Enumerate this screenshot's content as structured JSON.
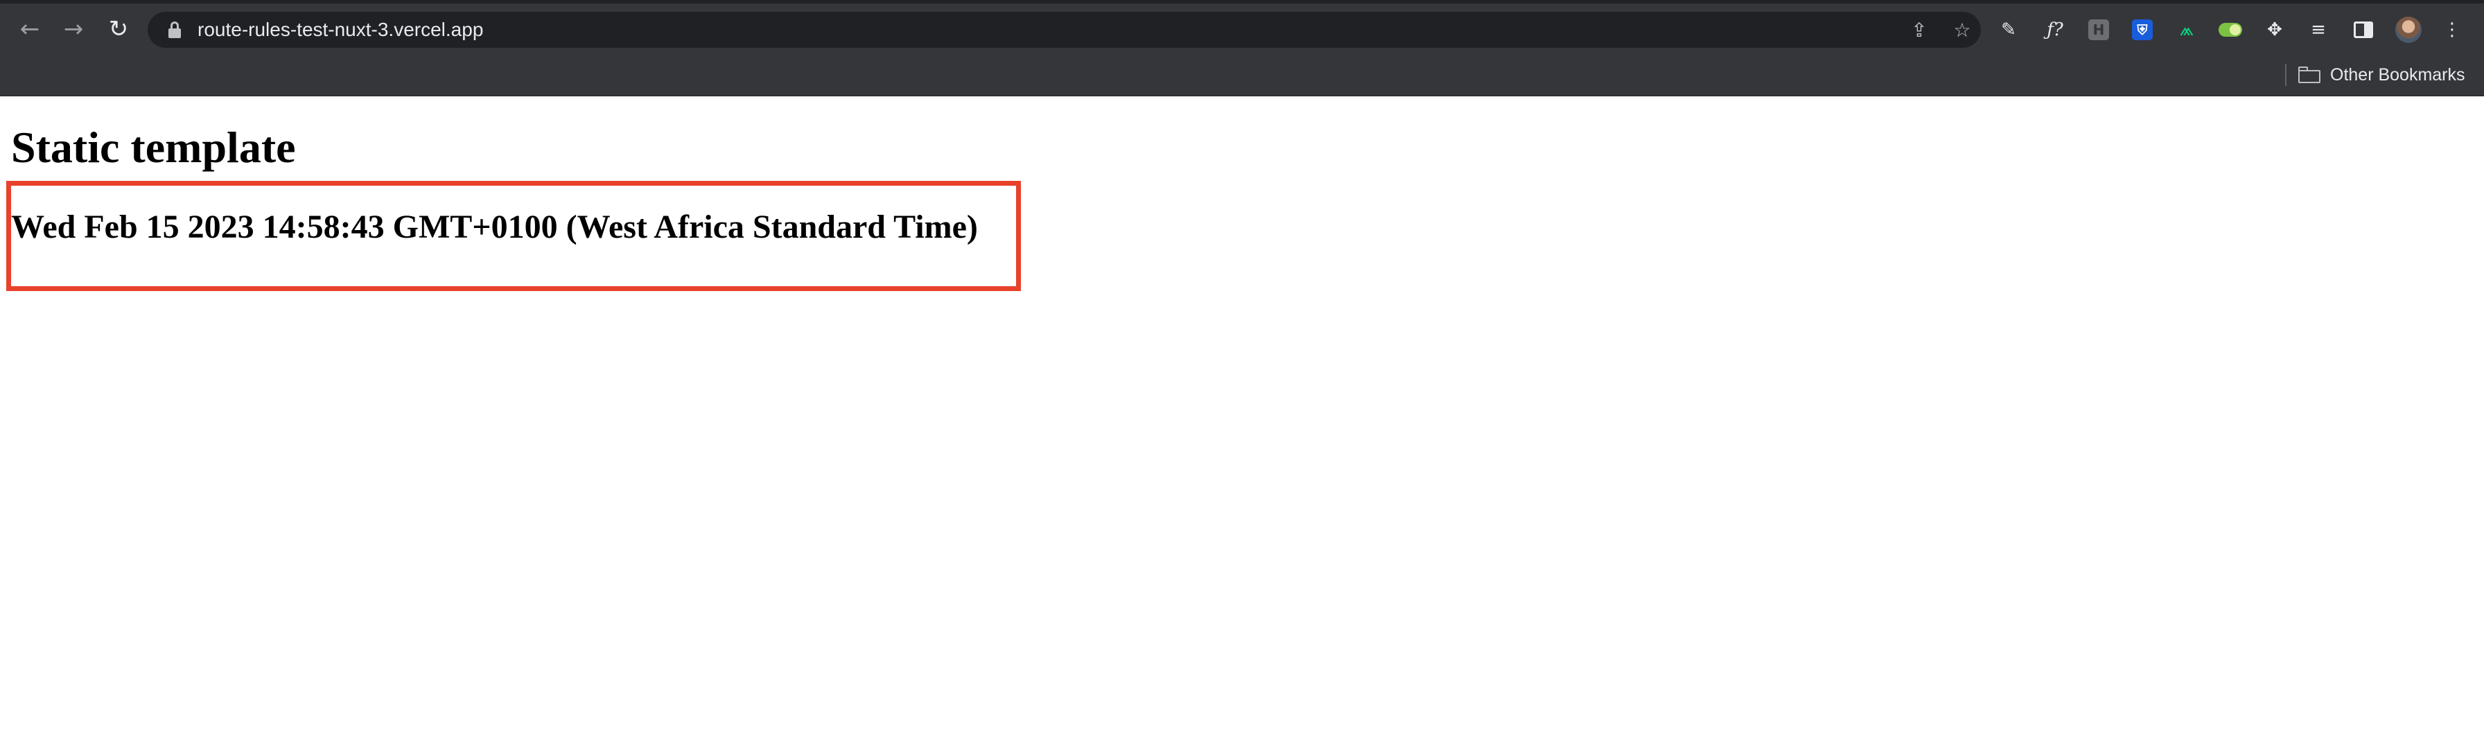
{
  "browser": {
    "address_bar": {
      "url": "route-rules-test-nuxt-3.vercel.app"
    },
    "nav": {
      "back_icon": "arrow-left-icon",
      "forward_icon": "arrow-right-icon",
      "reload_icon": "reload-icon"
    },
    "omnibox_actions": [
      "share-icon",
      "star-icon"
    ],
    "extensions": [
      {
        "name": "pen-extension-icon",
        "glyph": "✎"
      },
      {
        "name": "fx-extension-icon",
        "glyph": "ƒ?"
      },
      {
        "name": "h-extension-icon",
        "glyph": "H"
      },
      {
        "name": "bitwarden-extension-icon",
        "glyph": "⛨"
      },
      {
        "name": "nuxt-extension-icon",
        "glyph": "⩕"
      },
      {
        "name": "toggle-extension-icon",
        "glyph": "●"
      },
      {
        "name": "puzzle-extension-icon",
        "glyph": "✥"
      },
      {
        "name": "reading-list-icon",
        "glyph": "≡"
      },
      {
        "name": "side-panel-icon",
        "glyph": "▮"
      },
      {
        "name": "profile-avatar",
        "glyph": ""
      },
      {
        "name": "kebab-menu-icon",
        "glyph": "⋮"
      }
    ],
    "colors": {
      "frame": "#35363a",
      "omnibox": "#202124",
      "text": "#e8eaed",
      "highlight": "#e8412c"
    },
    "bookmarks_bar": {
      "other_bookmarks_label": "Other Bookmarks"
    }
  },
  "page": {
    "title": "Static template",
    "date_text": "Wed Feb 15 2023 14:58:43 GMT+0100 (West Africa Standard Time)"
  }
}
